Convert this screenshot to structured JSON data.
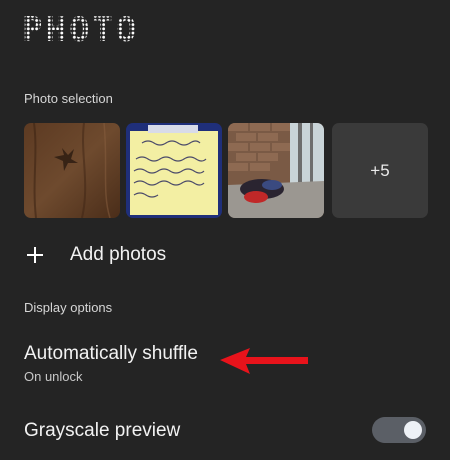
{
  "header": {
    "title": "PHOTO"
  },
  "photo_selection": {
    "label": "Photo selection",
    "thumbnails": [
      {
        "description": "wood-grain-photo"
      },
      {
        "description": "handwritten-note-photo"
      },
      {
        "description": "window-room-photo"
      }
    ],
    "more_count_label": "+5",
    "add_label": "Add photos"
  },
  "display_options": {
    "label": "Display options",
    "shuffle": {
      "title": "Automatically shuffle",
      "subtitle": "On unlock"
    },
    "grayscale": {
      "title": "Grayscale preview",
      "enabled": true
    }
  },
  "colors": {
    "background": "#242424",
    "annotation_arrow": "#e8131b",
    "toggle_track": "#5b5f66"
  }
}
